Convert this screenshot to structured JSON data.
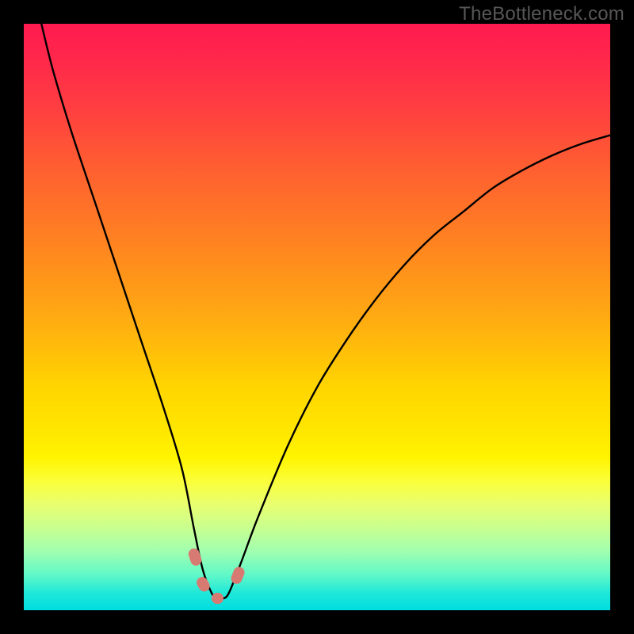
{
  "watermark": "TheBottleneck.com",
  "chart_data": {
    "type": "line",
    "title": "",
    "xlabel": "",
    "ylabel": "",
    "xlim": [
      0,
      100
    ],
    "ylim": [
      0,
      100
    ],
    "series": [
      {
        "name": "bottleneck-curve",
        "x": [
          3,
          5,
          8,
          12,
          16,
          20,
          24,
          27,
          29,
          30.5,
          32,
          33,
          34,
          35,
          37,
          40,
          45,
          50,
          55,
          60,
          65,
          70,
          75,
          80,
          85,
          90,
          95,
          100
        ],
        "y": [
          100,
          92,
          82,
          70,
          58,
          46,
          34,
          24,
          14,
          7,
          3,
          2,
          2,
          3,
          8,
          16,
          28,
          38,
          46,
          53,
          59,
          64,
          68,
          72,
          75,
          77.5,
          79.5,
          81
        ]
      }
    ],
    "highlight_segments": [
      {
        "name": "left-upper",
        "x": 29.2,
        "y": 9.0,
        "length": 6,
        "angle": 72
      },
      {
        "name": "left-lower",
        "x": 30.6,
        "y": 4.5,
        "length": 5,
        "angle": 60
      },
      {
        "name": "bottom",
        "x": 33.0,
        "y": 2.0,
        "length": 4,
        "angle": 0
      },
      {
        "name": "right",
        "x": 36.5,
        "y": 6.0,
        "length": 6,
        "angle": -68
      }
    ],
    "gradient_stops": [
      {
        "pos": 0,
        "color": "#ff1a50"
      },
      {
        "pos": 50,
        "color": "#ffaa12"
      },
      {
        "pos": 74,
        "color": "#fff400"
      },
      {
        "pos": 100,
        "color": "#00dde0"
      }
    ]
  }
}
